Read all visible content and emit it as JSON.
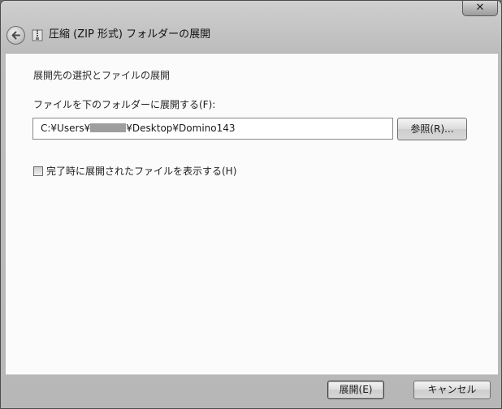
{
  "window": {
    "title": "圧縮 (ZIP 形式) フォルダーの展開",
    "close_label": "✕"
  },
  "content": {
    "heading": "展開先の選択とファイルの展開",
    "field_label": "ファイルを下のフォルダーに展開する(F):",
    "path_prefix": "C:¥Users¥",
    "path_suffix": "¥Desktop¥Domino143",
    "browse_label": "参照(R)...",
    "checkbox_label": "完了時に展開されたファイルを表示する(H)",
    "checkbox_checked": false
  },
  "footer": {
    "extract_label": "展開(E)",
    "cancel_label": "キャンセル"
  },
  "icons": {
    "back": "back-arrow-icon",
    "folder": "zip-folder-icon",
    "close": "close-icon"
  }
}
